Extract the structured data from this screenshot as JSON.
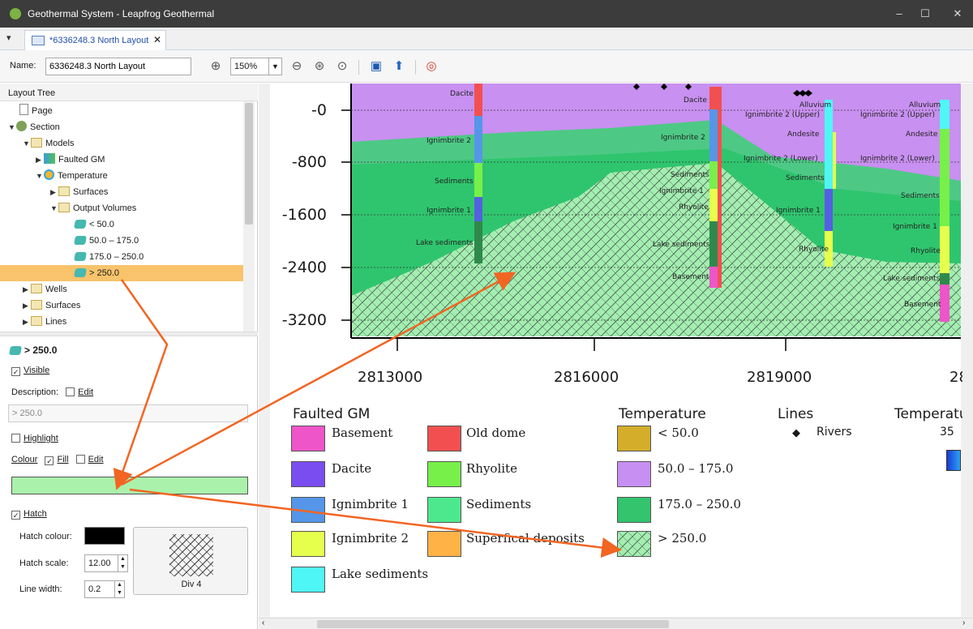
{
  "window": {
    "title": "Geothermal System - Leapfrog Geothermal",
    "controls": [
      "–",
      "☐",
      "✕"
    ]
  },
  "tab": {
    "label": "*6336248.3 North Layout",
    "close": "✕"
  },
  "toolbar": {
    "name_label": "Name:",
    "name_value": "6336248.3 North Layout",
    "zoom": "150%"
  },
  "tree": {
    "header": "Layout Tree",
    "items": [
      {
        "label": "Page"
      },
      {
        "label": "Section"
      },
      {
        "label": "Models"
      },
      {
        "label": "Faulted GM"
      },
      {
        "label": "Temperature"
      },
      {
        "label": "Surfaces"
      },
      {
        "label": "Output Volumes"
      },
      {
        "label": "< 50.0"
      },
      {
        "label": "50.0 – 175.0"
      },
      {
        "label": "175.0 – 250.0"
      },
      {
        "label": "> 250.0"
      },
      {
        "label": "Wells"
      },
      {
        "label": "Surfaces"
      },
      {
        "label": "Lines"
      }
    ]
  },
  "props": {
    "title": "> 250.0",
    "visible": "Visible",
    "description": "Description:",
    "edit": "Edit",
    "description_value": "> 250.0",
    "highlight": "Highlight",
    "colour": "Colour",
    "fill": "Fill",
    "fill_colour": "#aaf2ab",
    "hatch": "Hatch",
    "hatch_colour_label": "Hatch colour:",
    "hatch_scale_label": "Hatch scale:",
    "hatch_scale": "12.00",
    "line_width_label": "Line width:",
    "line_width": "0.2",
    "pattern_name": "Div 4"
  },
  "section": {
    "y_ticks": [
      "-0",
      "-800",
      "-1600",
      "-2400",
      "-3200"
    ],
    "x_ticks": [
      "2813000",
      "2816000",
      "2819000",
      "28"
    ],
    "labels": {
      "dacite_a": "Dacite",
      "dacite_b": "Dacite",
      "ign2_a": "Ignimbrite 2",
      "ign2_b": "Ignimbrite 2",
      "sed_a": "Sediments",
      "sed_b": "Sediments",
      "sed_c": "Sediments",
      "sed_d": "Sediments",
      "ign1_a": "Ignimbrite 1",
      "ign1_b": "Ignimbrite 1",
      "ign1_c": "Ignimbrite 1",
      "ign1_d": "Ignimbrite 1",
      "lake_a": "Lake sediments",
      "lake_b": "Lake sediments",
      "lake_c": "Lake sediments",
      "rhy_a": "Rhyolite",
      "rhy_b": "Rhyolite",
      "rhy_c": "Rhyolite",
      "base_a": "Basement",
      "base_b": "Basement",
      "alluv_a": "Alluvium",
      "alluv_b": "Alluvium",
      "ign2u_a": "Ignimbrite 2 (Upper)",
      "ign2u_b": "Ignimbrite 2 (Upper)",
      "and_a": "Andesite",
      "and_b": "Andesite",
      "ign2l_a": "Ignimbrite 2 (Lower)",
      "ign2l_b": "Ignimbrite 2 (Lower)"
    }
  },
  "legend": {
    "faulted_title": "Faulted GM",
    "faulted": [
      {
        "label": "Basement",
        "color": "#ee55c8"
      },
      {
        "label": "Old dome",
        "color": "#f25050"
      },
      {
        "label": "Dacite",
        "color": "#7a4df0"
      },
      {
        "label": "Rhyolite",
        "color": "#77f04a"
      },
      {
        "label": "Ignimbrite 1",
        "color": "#5596e8"
      },
      {
        "label": "Sediments",
        "color": "#4de88e"
      },
      {
        "label": "Ignimbrite 2",
        "color": "#e6ff4d"
      },
      {
        "label": "Superfical deposits",
        "color": "#ffb347"
      },
      {
        "label": "Lake sediments",
        "color": "#4ff6f6"
      }
    ],
    "temp_title": "Temperature",
    "temp": [
      {
        "label": "< 50.0",
        "color": "#d4ad2a"
      },
      {
        "label": "50.0 – 175.0",
        "color": "#c78ff2"
      },
      {
        "label": "175.0 – 250.0",
        "color": "#33c46d"
      },
      {
        "label": "> 250.0",
        "color": "#aaf2ab"
      }
    ],
    "lines_title": "Lines",
    "rivers": "Rivers",
    "temp2_title": "Temperatu",
    "temp2_value": "35"
  }
}
